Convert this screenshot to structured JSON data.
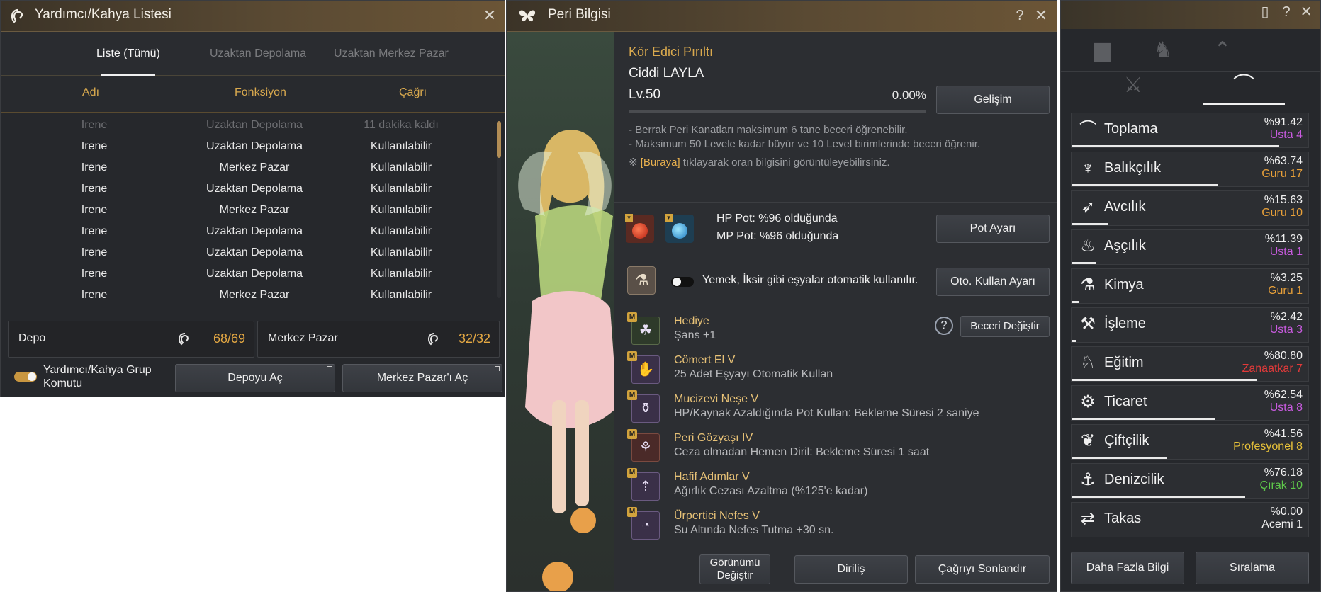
{
  "maid_window": {
    "title": "Yardımcı/Kahya Listesi",
    "tabs": [
      "Liste (Tümü)",
      "Uzaktan Depolama",
      "Uzaktan Merkez Pazar"
    ],
    "columns": [
      "Adı",
      "Fonksiyon",
      "Çağrı"
    ],
    "rows": [
      {
        "name": "Irene",
        "function": "Uzaktan Depolama",
        "status": "11 dakika kaldı"
      },
      {
        "name": "Irene",
        "function": "Uzaktan Depolama",
        "status": "Kullanılabilir"
      },
      {
        "name": "Irene",
        "function": "Merkez Pazar",
        "status": "Kullanılabilir"
      },
      {
        "name": "Irene",
        "function": "Uzaktan Depolama",
        "status": "Kullanılabilir"
      },
      {
        "name": "Irene",
        "function": "Merkez Pazar",
        "status": "Kullanılabilir"
      },
      {
        "name": "Irene",
        "function": "Uzaktan Depolama",
        "status": "Kullanılabilir"
      },
      {
        "name": "Irene",
        "function": "Uzaktan Depolama",
        "status": "Kullanılabilir"
      },
      {
        "name": "Irene",
        "function": "Uzaktan Depolama",
        "status": "Kullanılabilir"
      },
      {
        "name": "Irene",
        "function": "Merkez Pazar",
        "status": "Kullanılabilir"
      }
    ],
    "storage": {
      "label": "Depo",
      "value": "68/69"
    },
    "market": {
      "label": "Merkez Pazar",
      "value": "32/32"
    },
    "group_toggle_label": "Yardımcı/Kahya Grup Komutu",
    "open_storage_button": "Depoyu Aç",
    "open_market_button": "Merkez Pazar'ı Aç"
  },
  "fairy_window": {
    "title": "Peri Bilgisi",
    "fairy_type": "Kör Edici Pırıltı",
    "fairy_name": "Ciddi LAYLA",
    "level": "Lv.50",
    "exp_percent": "0.00%",
    "growth_button": "Gelişim",
    "notes": [
      "- Berrak Peri Kanatları maksimum 6 tane beceri öğrenebilir.",
      "- Maksimum 50 Levele kadar büyür ve 10 Level birimlerinde beceri öğrenir."
    ],
    "note3_prefix": "※ ",
    "note3_link": "[Buraya]",
    "note3_suffix": " tıklayarak oran bilgisini görüntüleyebilirsiniz.",
    "hp_pot_text": "HP Pot: %96 olduğunda",
    "mp_pot_text": "MP Pot: %96 olduğunda",
    "pot_settings_button": "Pot Ayarı",
    "auto_use_text": "Yemek, İksir gibi eşyalar otomatik kullanılır.",
    "auto_use_button": "Oto. Kullan Ayarı",
    "change_skill_button": "Beceri Değiştir",
    "skill_badge": "M",
    "skills": [
      {
        "name": "Hediye",
        "desc": "Şans +1",
        "icon": "clover-icon"
      },
      {
        "name": "Cömert El V",
        "desc": "25 Adet Eşyayı Otomatik Kullan",
        "icon": "hand-icon"
      },
      {
        "name": "Mucizevi Neşe V",
        "desc": "HP/Kaynak Azaldığında Pot Kullan: Bekleme Süresi 2 saniye",
        "icon": "potion-icon"
      },
      {
        "name": "Peri Gözyaşı IV",
        "desc": "Ceza olmadan Hemen Diril: Bekleme Süresi 1 saat",
        "icon": "tear-icon"
      },
      {
        "name": "Hafif Adımlar V",
        "desc": "Ağırlık Cezası Azaltma (%125'e kadar)",
        "icon": "weight-icon"
      },
      {
        "name": "Ürpertici Nefes V",
        "desc": "Su Altında Nefes Tutma +30 sn.",
        "icon": "breath-icon"
      }
    ],
    "change_look_button": "Görünümü Değiştir",
    "revive_button": "Diriliş",
    "end_summon_button": "Çağrıyı Sonlandır"
  },
  "life_window": {
    "skills": [
      {
        "name": "Toplama",
        "percent": "%91.42",
        "rank": "Usta 4",
        "rank_color": "#c95be0",
        "fill": 0.91,
        "icon": "gathering-icon"
      },
      {
        "name": "Balıkçılık",
        "percent": "%63.74",
        "rank": "Guru 17",
        "rank_color": "#e8a039",
        "fill": 0.64,
        "icon": "fishing-icon"
      },
      {
        "name": "Avcılık",
        "percent": "%15.63",
        "rank": "Guru 10",
        "rank_color": "#e8a039",
        "fill": 0.16,
        "icon": "hunting-icon"
      },
      {
        "name": "Aşçılık",
        "percent": "%11.39",
        "rank": "Usta 1",
        "rank_color": "#c95be0",
        "fill": 0.11,
        "icon": "cooking-icon"
      },
      {
        "name": "Kimya",
        "percent": "%3.25",
        "rank": "Guru 1",
        "rank_color": "#e8a039",
        "fill": 0.03,
        "icon": "alchemy-icon"
      },
      {
        "name": "İşleme",
        "percent": "%2.42",
        "rank": "Usta 3",
        "rank_color": "#c95be0",
        "fill": 0.02,
        "icon": "processing-icon"
      },
      {
        "name": "Eğitim",
        "percent": "%80.80",
        "rank": "Zanaatkar 7",
        "rank_color": "#e23a3a",
        "fill": 0.81,
        "icon": "training-icon"
      },
      {
        "name": "Ticaret",
        "percent": "%62.54",
        "rank": "Usta 8",
        "rank_color": "#c95be0",
        "fill": 0.63,
        "icon": "trade-icon"
      },
      {
        "name": "Çiftçilik",
        "percent": "%41.56",
        "rank": "Profesyonel 8",
        "rank_color": "#e8c23a",
        "fill": 0.42,
        "icon": "farming-icon"
      },
      {
        "name": "Denizcilik",
        "percent": "%76.18",
        "rank": "Çırak 10",
        "rank_color": "#5ec84a",
        "fill": 0.76,
        "icon": "sailing-icon"
      },
      {
        "name": "Takas",
        "percent": "%0.00",
        "rank": "Acemi 1",
        "rank_color": "#f0f0f0",
        "fill": 0.0,
        "icon": "barter-icon"
      }
    ],
    "more_info_button": "Daha Fazla Bilgi",
    "ranking_button": "Sıralama"
  }
}
